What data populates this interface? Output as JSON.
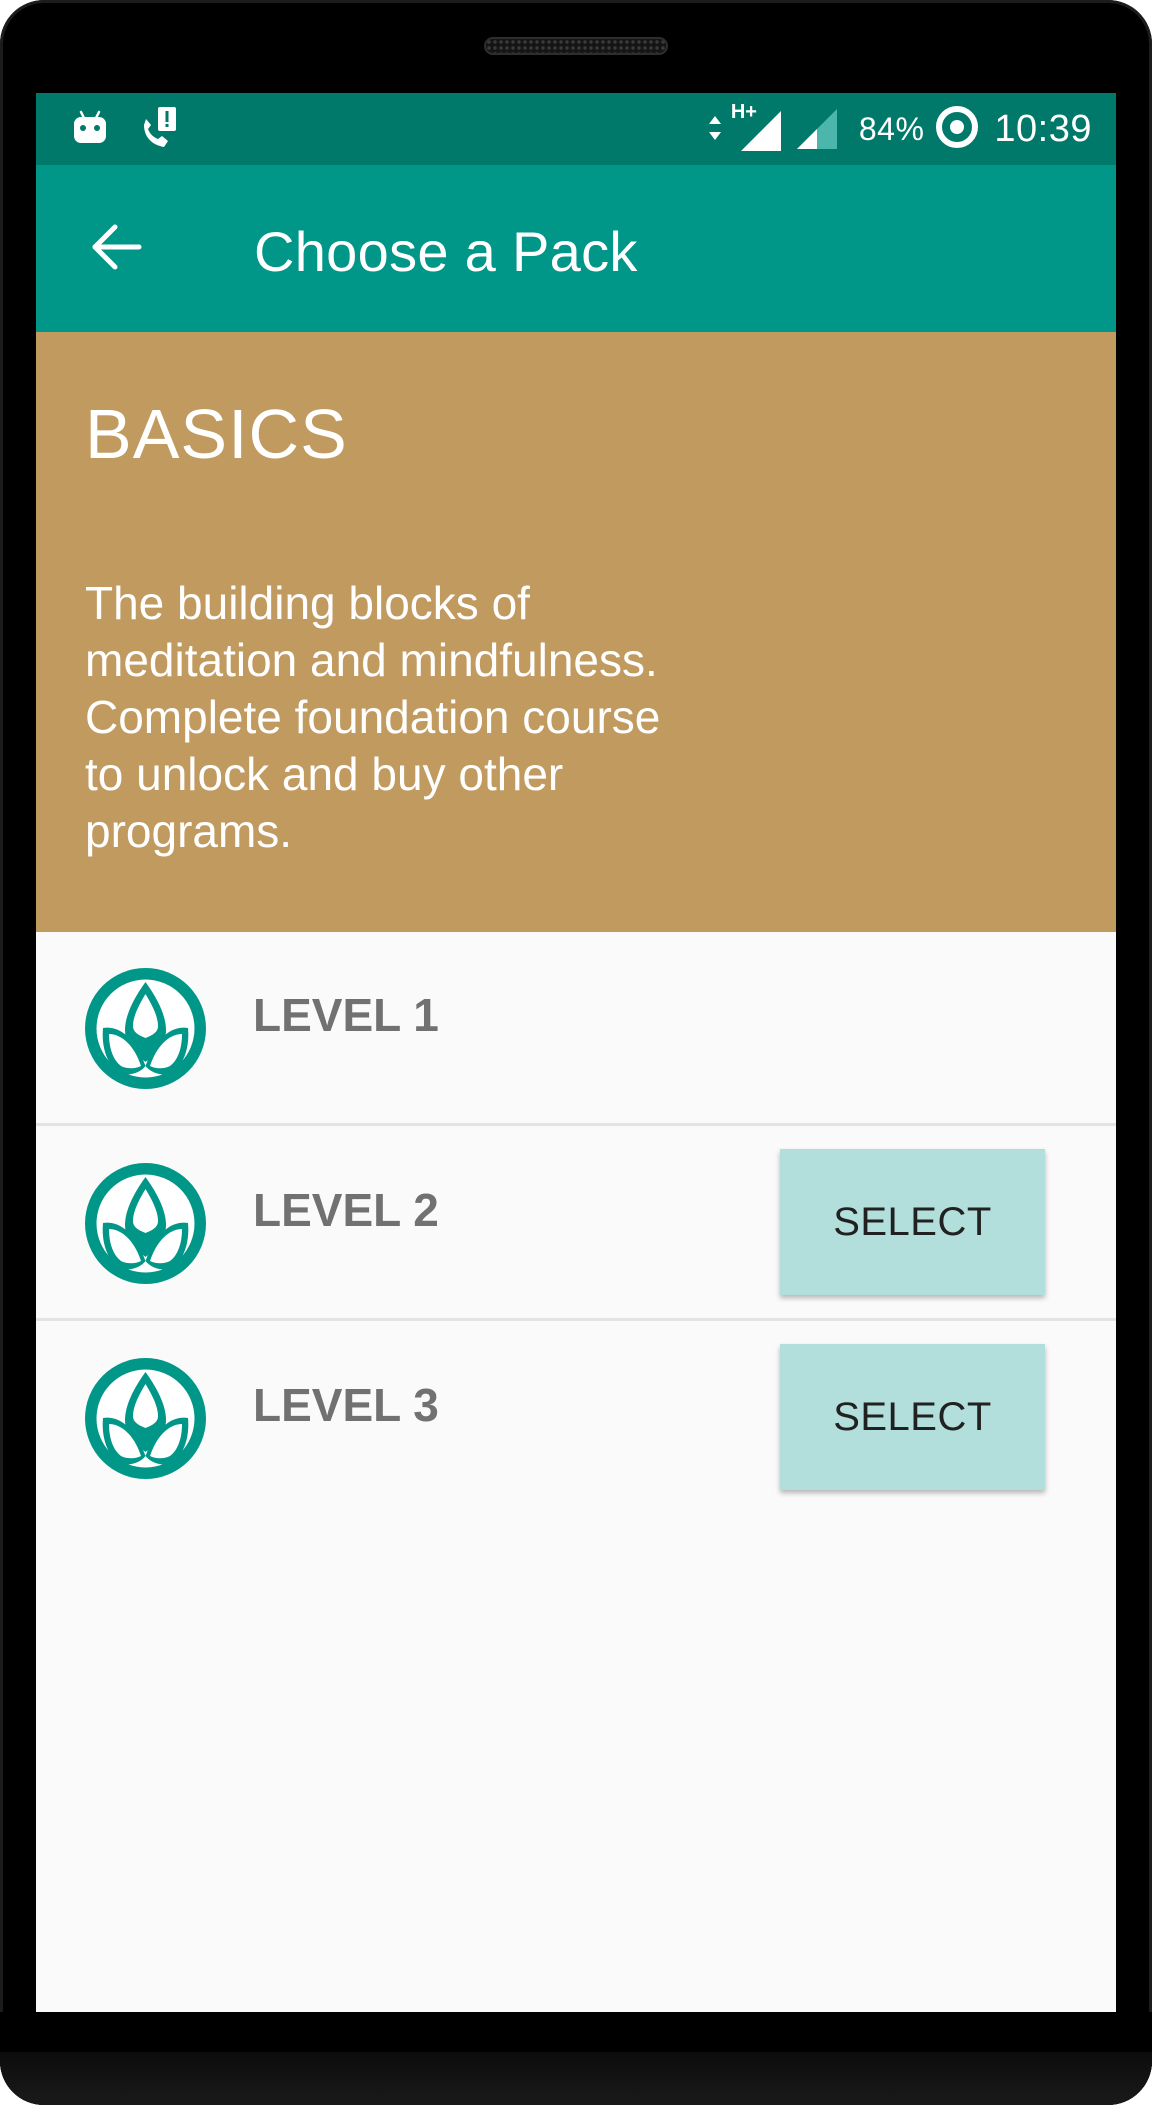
{
  "status_bar": {
    "network_type": "H+",
    "battery": "84%",
    "time": "10:39",
    "icons": [
      "android-icon",
      "phone-alert-icon",
      "data-arrows-icon",
      "signal-full-icon",
      "signal-partial-icon",
      "battery-ring-icon"
    ]
  },
  "app_bar": {
    "back_icon": "arrow-left-icon",
    "title": "Choose a Pack"
  },
  "pack": {
    "name": "BASICS",
    "description": "The building blocks of meditation and mindfulness. Complete foundation course to unlock and buy other programs.",
    "color": "#c19a60"
  },
  "levels": [
    {
      "label": "LEVEL 1",
      "icon": "lotus-icon",
      "button": null
    },
    {
      "label": "LEVEL 2",
      "icon": "lotus-icon",
      "button": "SELECT"
    },
    {
      "label": "LEVEL 3",
      "icon": "lotus-icon",
      "button": "SELECT"
    }
  ],
  "colors": {
    "status_bar": "#00796b",
    "app_bar": "#009688",
    "select_button": "#b2dfdb",
    "level_text": "#717171"
  }
}
